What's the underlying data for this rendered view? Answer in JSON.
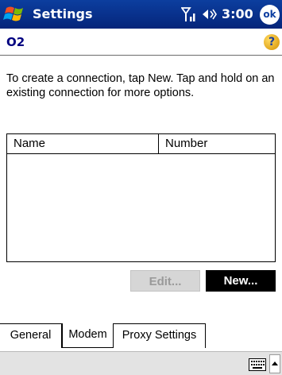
{
  "titlebar": {
    "app_title": "Settings",
    "time": "3:00",
    "ok_label": "ok",
    "icons": [
      "windows-start-icon",
      "signal-icon",
      "volume-icon"
    ]
  },
  "page": {
    "title": "O2",
    "help_label": "?",
    "instructions": "To create a connection, tap New. Tap and hold on an existing connection for more options."
  },
  "list": {
    "columns": [
      "Name",
      "Number"
    ],
    "rows": []
  },
  "buttons": {
    "edit_label": "Edit...",
    "new_label": "New..."
  },
  "tabs": [
    {
      "label": "General",
      "selected": false
    },
    {
      "label": "Modem",
      "selected": true
    },
    {
      "label": "Proxy Settings",
      "selected": false
    }
  ],
  "command_bar": {
    "icons": [
      "keyboard-icon",
      "input-menu-arrow-icon"
    ]
  },
  "colors": {
    "titlebar": "#0c3e9f",
    "page_title": "#000080",
    "command_bar": "#e3e3e3"
  }
}
